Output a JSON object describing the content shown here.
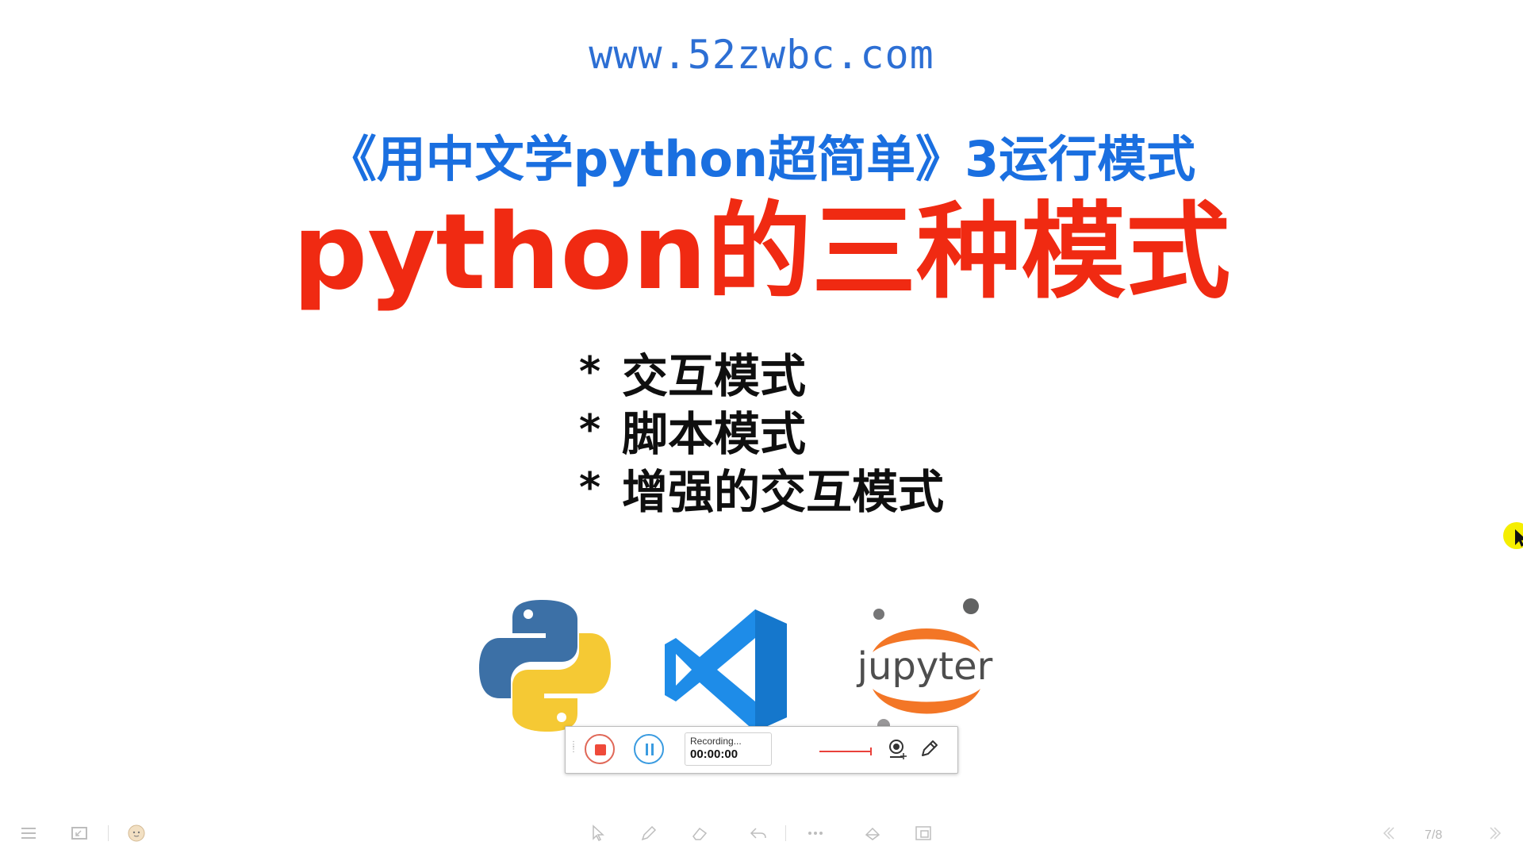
{
  "slide": {
    "url": "www.52zwbc.com",
    "subtitle": "《用中文学python超简单》3运行模式",
    "title": "python的三种模式",
    "bullet_marker": "*",
    "bullets": [
      "交互模式",
      "脚本模式",
      "增强的交互模式"
    ],
    "logos": [
      "python-logo",
      "vscode-logo",
      "jupyter-logo"
    ],
    "jupyter_wordmark": "jupyter"
  },
  "recorder": {
    "status": "Recording...",
    "time": "00:00:00",
    "colors": {
      "stop": "#ef4a3a",
      "pause": "#3a9be0"
    }
  },
  "bottom_bar": {
    "page_indicator": "7/8"
  },
  "colors": {
    "url": "#2d6fd4",
    "subtitle": "#1a6fe0",
    "title": "#f02a12",
    "bullets": "#0f0f0f"
  }
}
